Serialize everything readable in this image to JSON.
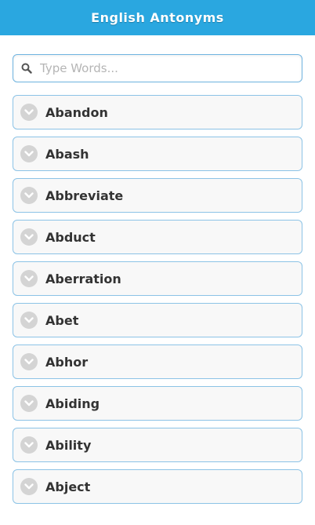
{
  "header": {
    "title": "English Antonyms"
  },
  "search": {
    "placeholder": "Type Words...",
    "value": ""
  },
  "words": [
    "Abandon",
    "Abash",
    "Abbreviate",
    "Abduct",
    "Aberration",
    "Abet",
    "Abhor",
    "Abiding",
    "Ability",
    "Abject"
  ],
  "colors": {
    "header_bg": "#2aa7e0",
    "item_border": "#8cc3e6",
    "item_bg": "#f8f8f8",
    "chevron_bg": "#d4d4d4"
  },
  "icons": {
    "search": "search-icon",
    "expand": "chevron-down-icon"
  }
}
